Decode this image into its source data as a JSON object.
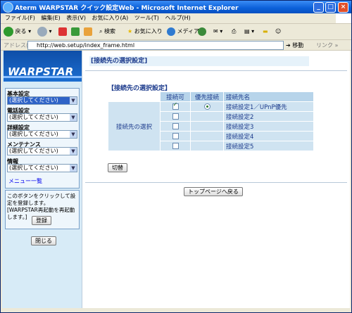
{
  "window": {
    "title": "Aterm WARPSTAR クイック設定Web - Microsoft Internet Explorer",
    "controls": [
      "_",
      "□",
      "×"
    ]
  },
  "menubar": [
    "ファイル(F)",
    "編集(E)",
    "表示(V)",
    "お気に入り(A)",
    "ツール(T)",
    "ヘルプ(H)"
  ],
  "toolbar": {
    "back": "戻る",
    "search": "検索",
    "favorites": "お気に入り",
    "media": "メディア"
  },
  "address": {
    "label": "アドレス(D)",
    "url": "http://web.setup/index_frame.html",
    "go": "移動",
    "links": "リンク"
  },
  "sidebar": {
    "logo": "WARPSTAR",
    "sections": [
      {
        "label": "基本設定",
        "selected": "(選択してください)"
      },
      {
        "label": "電話設定",
        "selected": "(選択してください)"
      },
      {
        "label": "詳細設定",
        "selected": "(選択してください)"
      },
      {
        "label": "メンテナンス",
        "selected": "(選択してください)"
      },
      {
        "label": "情報",
        "selected": "(選択してください)"
      }
    ],
    "menu_list_link": "メニュー一覧",
    "note": "このボタンをクリックして設定を登録します。[WARPSTAR再起動を再起動します。]",
    "register_button": "登録",
    "close_button": "閉じる"
  },
  "main": {
    "header": "[接続先の選択設定]",
    "subtitle": "【接続先の選択設定】",
    "table": {
      "columns": [
        "接続可",
        "優先接続",
        "接続先名"
      ],
      "row_label": "接続先の選択",
      "rows": [
        {
          "name": "接続設定1／UPnP優先",
          "enabled": true,
          "priority": true
        },
        {
          "name": "接続設定2",
          "enabled": false,
          "priority": false
        },
        {
          "name": "接続設定3",
          "enabled": false,
          "priority": false
        },
        {
          "name": "接続設定4",
          "enabled": false,
          "priority": false
        },
        {
          "name": "接続設定5",
          "enabled": false,
          "priority": false
        }
      ]
    },
    "switch_button": "切替",
    "top_page_button": "トップページへ戻る"
  },
  "colors": {
    "titlebar": "#0a5fd8",
    "sidebar_bg": "#d7ebf7",
    "table_header": "#b7d4ea",
    "table_cell": "#cfe3f1",
    "heading_text": "#1b3a8c"
  }
}
